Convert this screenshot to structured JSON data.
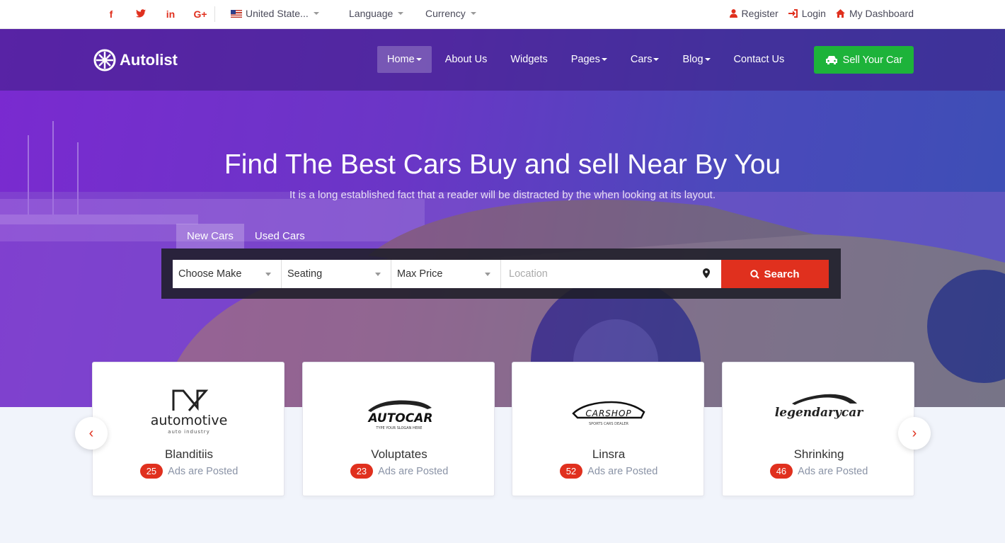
{
  "topbar": {
    "social": [
      {
        "icon": "facebook-icon",
        "glyph": "f"
      },
      {
        "icon": "twitter-icon",
        "glyph": "t"
      },
      {
        "icon": "linkedin-icon",
        "glyph": "in"
      },
      {
        "icon": "google-plus-icon",
        "glyph": "G+"
      }
    ],
    "country": "United State...",
    "language": "Language",
    "currency": "Currency",
    "register": "Register",
    "login": "Login",
    "dashboard": "My Dashboard"
  },
  "brand": {
    "name": "Autolist"
  },
  "nav": {
    "home": "Home",
    "about": "About Us",
    "widgets": "Widgets",
    "pages": "Pages",
    "cars": "Cars",
    "blog": "Blog",
    "contact": "Contact Us",
    "sell": "Sell Your Car"
  },
  "hero": {
    "title": "Find The Best Cars Buy and sell Near By You",
    "subtitle": "It is a long established fact that a reader will be distracted by the when looking at its layout."
  },
  "search": {
    "tab_new": "New Cars",
    "tab_used": "Used Cars",
    "make": "Choose Make",
    "seating": "Seating",
    "max_price": "Max Price",
    "location_placeholder": "Location",
    "button": "Search"
  },
  "brands": [
    {
      "name": "Blanditiis",
      "count": "25",
      "ads_label": "Ads are Posted",
      "logo_text": "automotive",
      "logo_sub": "auto industry"
    },
    {
      "name": "Voluptates",
      "count": "23",
      "ads_label": "Ads are Posted",
      "logo_text": "AUTOCAR",
      "logo_sub": "TYPE YOUR SLOGAN HERE"
    },
    {
      "name": "Linsra",
      "count": "52",
      "ads_label": "Ads are Posted",
      "logo_text": "CARSHOP",
      "logo_sub": "SPORTS CARS DEALER"
    },
    {
      "name": "Shrinking",
      "count": "46",
      "ads_label": "Ads are Posted",
      "logo_text": "legendarycar",
      "logo_sub": ""
    }
  ],
  "carousel": {
    "prev": "‹",
    "next": "›"
  },
  "colors": {
    "accent": "#e0301e",
    "green": "#1db33a",
    "hero_start": "#7a2ad0",
    "hero_end": "#3c4fb5"
  }
}
